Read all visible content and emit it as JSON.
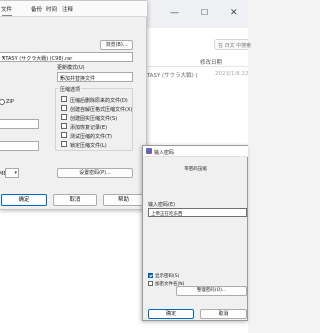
{
  "explorer": {
    "search_hint": "在 日文 中搜索",
    "column_modified": "修改日期",
    "file_name_partial": "XTASY (サクラ大戦) (",
    "file_date": "2023/1/8 22"
  },
  "archive_window": {
    "tabs": [
      "文件",
      "备份",
      "时间",
      "注释"
    ],
    "browse_label": "浏览(B)...",
    "archive_name": "XTASY (サクラ大戦) (C98).rar",
    "update_mode_label": "更新模式(U)",
    "update_mode_value": "添加并替换文件",
    "archive_format_partial": "ZIP",
    "options_header": "压缩选项",
    "options": [
      {
        "label": "压缩后删除原来的文件(D)",
        "checked": false
      },
      {
        "label": "创建自解压格式压缩文件(X)",
        "checked": false
      },
      {
        "label": "创建固实压缩文件(S)",
        "checked": false
      },
      {
        "label": "添加恢复记录(E)",
        "checked": false
      },
      {
        "label": "测试压缩的文件(T)",
        "checked": false
      },
      {
        "label": "锁定压缩文件(L)",
        "checked": false
      }
    ],
    "split_unit": "MB",
    "set_password_label": "设置密码(P)...",
    "ok_label": "确定",
    "cancel_label": "取消",
    "help_label": "帮助"
  },
  "password_dialog": {
    "title": "输入密码",
    "subtitle": "带密码压缩",
    "field_label": "输入密码(E)",
    "field_value": "上帝正在吃东西",
    "show_password_label": "显示密码(S)",
    "show_password_checked": true,
    "encrypt_names_label": "加密文件名(N)",
    "encrypt_names_checked": false,
    "organize_label": "整理密码(O)...",
    "ok_label": "确定",
    "cancel_label": "取消"
  }
}
